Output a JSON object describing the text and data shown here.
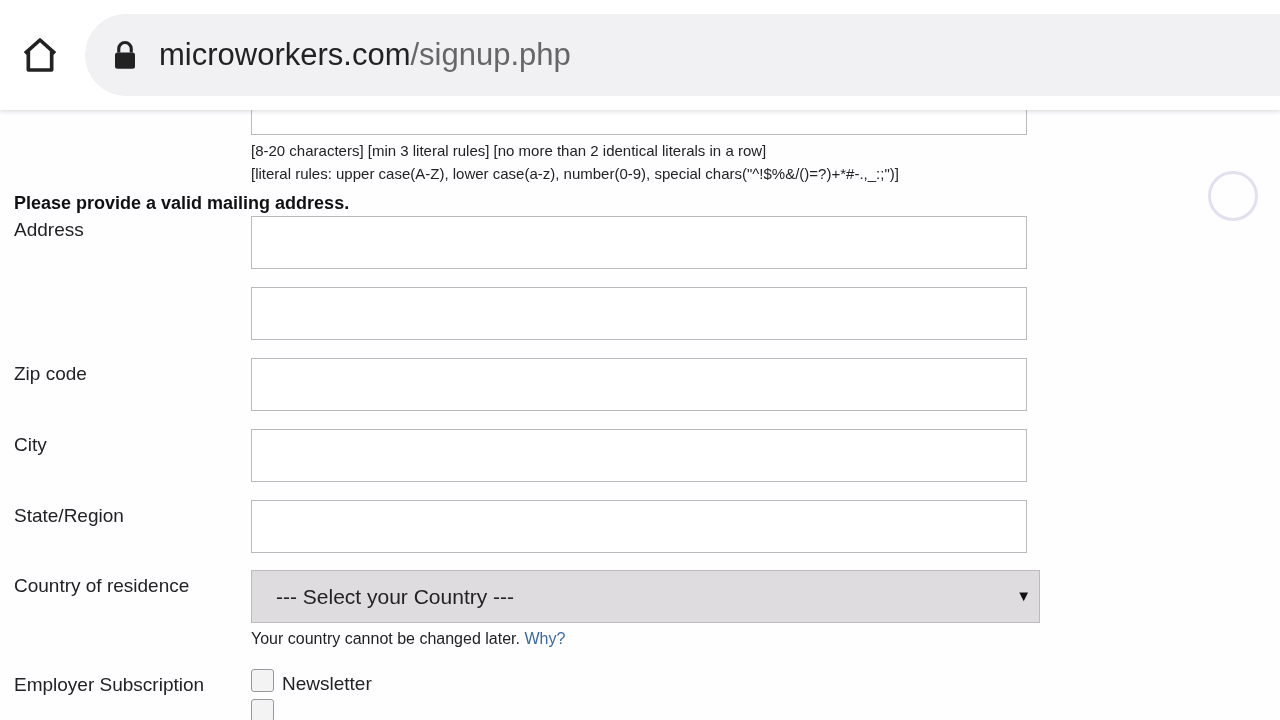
{
  "browser": {
    "url_host": "microworkers.com",
    "url_path": "/signup.php"
  },
  "password_hints": [
    "[8-20 characters] [min 3 literal rules] [no more than 2 identical literals in a row]",
    "[literal rules: upper case(A-Z), lower case(a-z), number(0-9), special chars(\"^!$%&/()=?)+*#-.,_:;\")]"
  ],
  "address_heading": "Please provide a valid mailing address.",
  "fields": [
    {
      "kind": "text",
      "label": "Address"
    },
    {
      "kind": "text"
    },
    {
      "kind": "text",
      "label": "Zip code"
    },
    {
      "kind": "text",
      "label": "City"
    },
    {
      "kind": "text",
      "label": "State/Region"
    }
  ],
  "country": {
    "label": "Country of residence",
    "value": "--- Select your Country ---",
    "arrow": "▼",
    "note": "Your country cannot be changed later.",
    "link": "Why?"
  },
  "subscription": {
    "label": "Employer Subscription",
    "options": [
      {
        "label": "Newsletter",
        "checked": false
      },
      {
        "checked": false
      }
    ]
  }
}
